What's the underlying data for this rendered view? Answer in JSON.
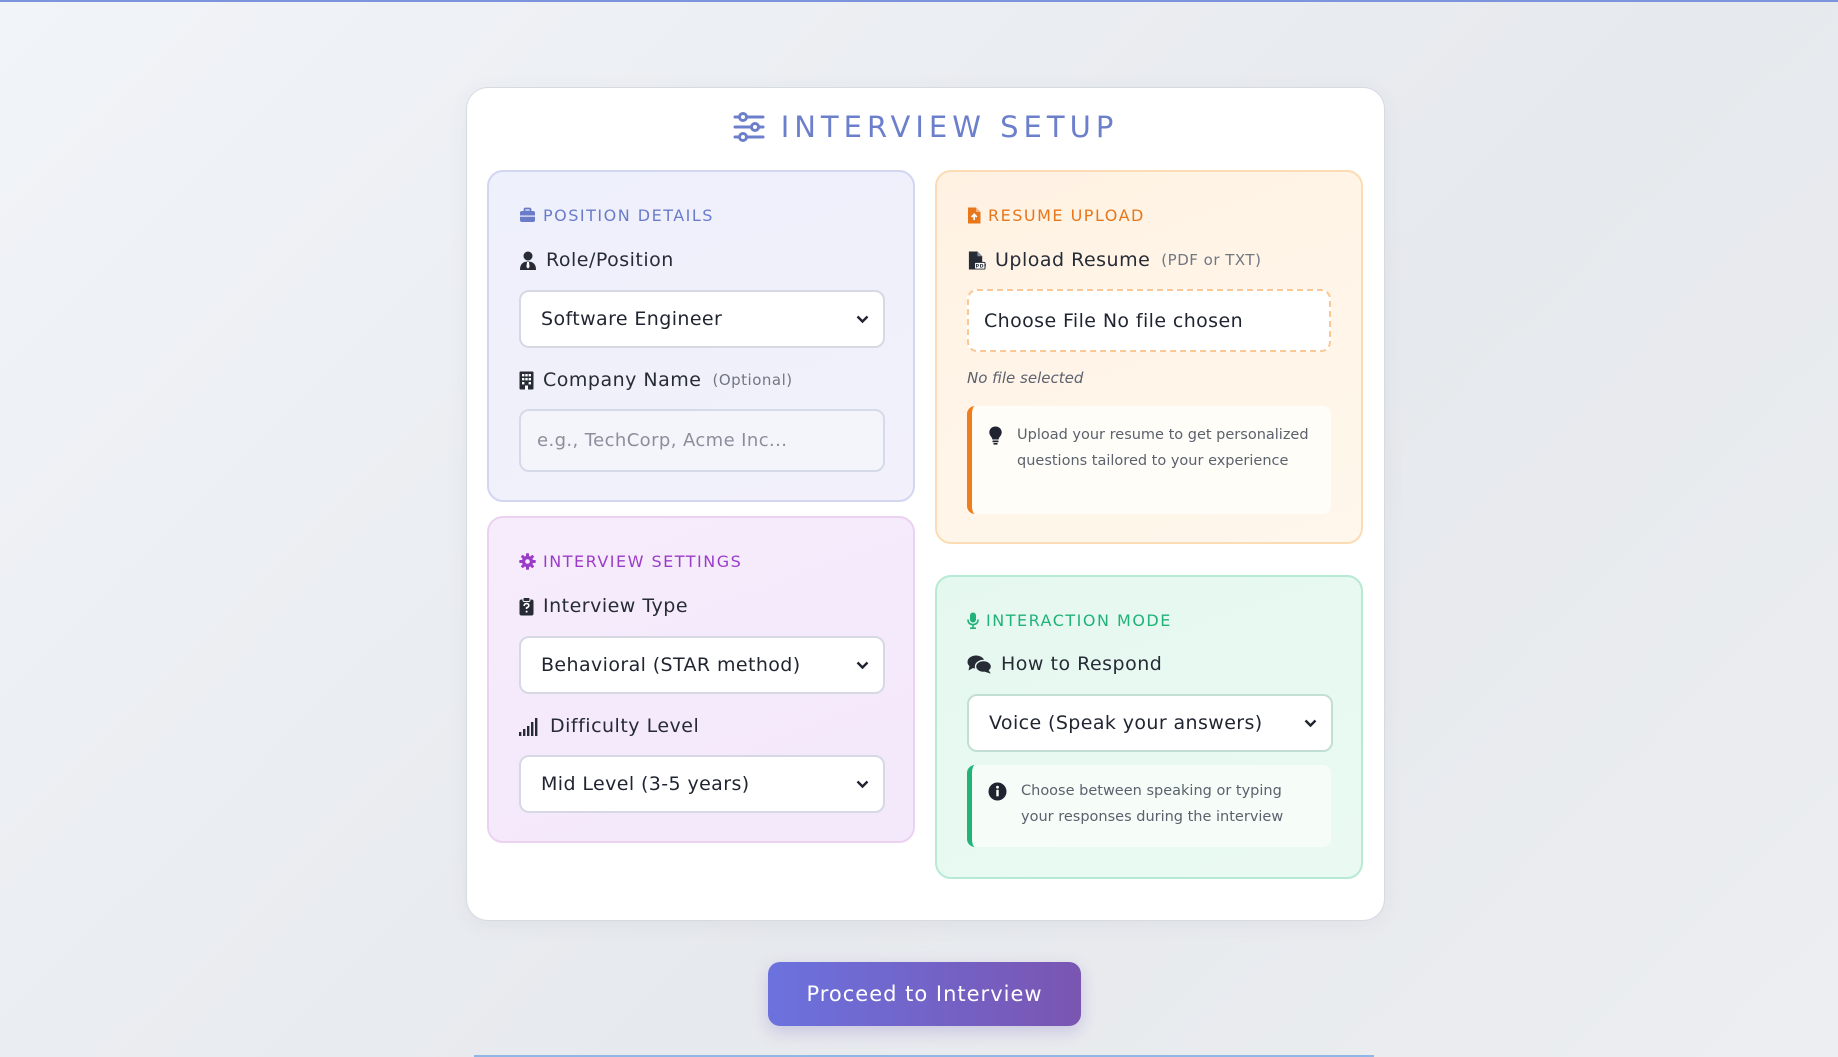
{
  "page": {
    "title": "INTERVIEW SETUP",
    "title_icon": "sliders-icon",
    "proceed_label": "Proceed to Interview"
  },
  "position": {
    "heading": "POSITION DETAILS",
    "heading_icon": "briefcase-icon",
    "role_label": "Role/Position",
    "role_icon": "user-tie-icon",
    "role_value": "Software Engineer",
    "company_label": "Company Name",
    "company_icon": "building-icon",
    "company_optional": "(Optional)",
    "company_placeholder": "e.g., TechCorp, Acme Inc..."
  },
  "settings": {
    "heading": "INTERVIEW SETTINGS",
    "heading_icon": "gear-icon",
    "type_label": "Interview Type",
    "type_icon": "clipboard-question-icon",
    "type_value": "Behavioral (STAR method)",
    "difficulty_label": "Difficulty Level",
    "difficulty_icon": "signal-bars-icon",
    "difficulty_value": "Mid Level (3-5 years)"
  },
  "resume": {
    "heading": "RESUME UPLOAD",
    "heading_icon": "file-upload-icon",
    "upload_label": "Upload Resume",
    "upload_icon": "file-pdf-icon",
    "upload_hint": "(PDF or TXT)",
    "file_button_text": "Choose File No file chosen",
    "status": "No file selected",
    "tip_icon": "lightbulb-icon",
    "tip": "Upload your resume to get personalized questions tailored to your experience"
  },
  "mode": {
    "heading": "INTERACTION MODE",
    "heading_icon": "microphone-icon",
    "respond_label": "How to Respond",
    "respond_icon": "comments-icon",
    "respond_value": "Voice (Speak your answers)",
    "tip_icon": "info-circle-icon",
    "tip": "Choose between speaking or typing your responses during the interview"
  },
  "colors": {
    "indigo": "#6a7cc9",
    "purple": "#9b3cc9",
    "orange": "#e8761a",
    "green": "#21b27a",
    "button_start": "#6b72de",
    "button_end": "#7a55b2"
  }
}
